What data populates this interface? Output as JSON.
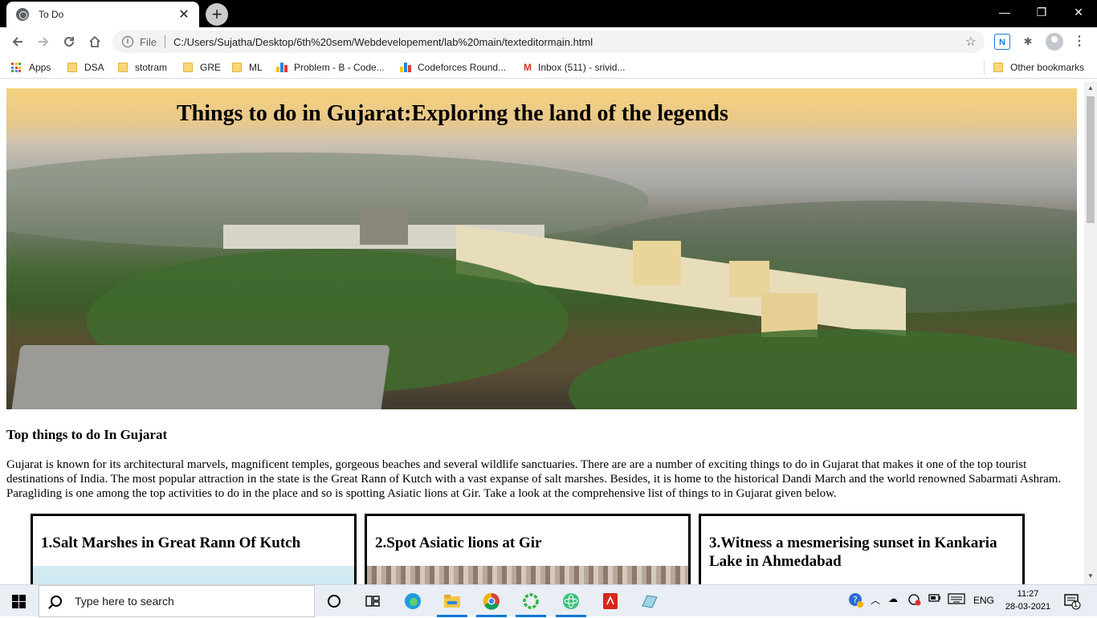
{
  "browser": {
    "tab_title": "To Do",
    "tab_close": "✕",
    "new_tab": "+",
    "window_controls": {
      "minimize": "—",
      "restore": "❐",
      "close": "✕"
    },
    "url_scheme": "File",
    "url": "C:/Users/Sujatha/Desktop/6th%20sem/Webdevelopement/lab%20main/texteditormain.html",
    "extension_label": "N"
  },
  "bookmarks": [
    {
      "label": "Apps",
      "icon": "apps-grid-icon"
    },
    {
      "label": "DSA",
      "icon": "folder-icon"
    },
    {
      "label": "stotram",
      "icon": "folder-icon"
    },
    {
      "label": "GRE",
      "icon": "folder-icon"
    },
    {
      "label": "ML",
      "icon": "folder-icon"
    },
    {
      "label": "Problem - B - Code...",
      "icon": "codeforces-icon"
    },
    {
      "label": "Codeforces Round...",
      "icon": "codeforces-icon"
    },
    {
      "label": "Inbox (511) - srivid...",
      "icon": "gmail-icon"
    }
  ],
  "other_bookmarks": "Other bookmarks",
  "page": {
    "hero_title": "Things to do in Gujarat:Exploring the land of the legends",
    "section_title": "Top things to do In Gujarat",
    "intro": "Gujarat is known for its architectural marvels, magnificent temples, gorgeous beaches and several wildlife sanctuaries. There are are a number of exciting things to do in Gujarat that makes it one of the top tourist destinations of India. The most popular attraction in the state is the Great Rann of Kutch with a vast expanse of salt marshes. Besides, it is home to the historical Dandi March and the world renowned Sabarmati Ashram. Paragliding is one among the top activities to do in the place and so is spotting Asiatic lions at Gir. Take a look at the comprehensive list of things to in Gujarat given below.",
    "cards": [
      {
        "title": "1.Salt Marshes in Great Rann Of Kutch"
      },
      {
        "title": "2.Spot Asiatic lions at Gir"
      },
      {
        "title": "3.Witness a mesmerising sunset in Kankaria Lake in Ahmedabad"
      }
    ]
  },
  "taskbar": {
    "search_placeholder": "Type here to search",
    "language": "ENG",
    "time": "11:27",
    "date": "28-03-2021",
    "notification_count": "1"
  },
  "colors": {
    "accent": "#0078d4",
    "chrome_frame": "#000000",
    "omnibox_bg": "#f1f3f4"
  }
}
